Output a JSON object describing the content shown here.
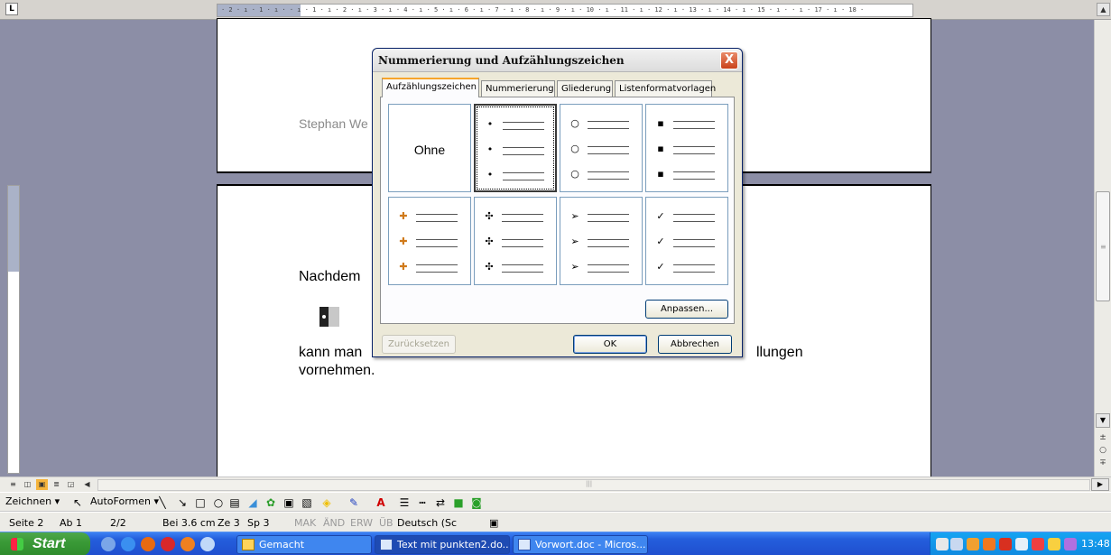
{
  "ruler": {
    "tab_selector": "L",
    "top_marks": "· 2 · ı · 1 · ı ·   · ı · 1 · ı · 2 · ı · 3 · ı · 4 · ı · 5 · ı · 6 · ı · 7 · ı · 8 · ı · 9 · ı · 10 · ı · 11 · ı · 12 · ı · 13 · ı · 14 · ı · 15 · ı ·  · ı · 17 · ı · 18 ·"
  },
  "document": {
    "page1_text": "Stephan We",
    "para1": "Nachdem",
    "para2_start": "kann man",
    "para2_end": "llungen",
    "para3": "vornehmen."
  },
  "dialog": {
    "title": "Nummerierung und Aufzählungszeichen",
    "close_label": "X",
    "tabs": [
      {
        "label": "Aufzählungszeichen",
        "active": true
      },
      {
        "label": "Nummerierung",
        "active": false
      },
      {
        "label": "Gliederung",
        "active": false
      },
      {
        "label": "Listenformatvorlagen",
        "active": false
      }
    ],
    "none_label": "Ohne",
    "bullet_styles": [
      {
        "symbol": "•",
        "color": "#000000",
        "selected": true
      },
      {
        "symbol": "○",
        "color": "#000000",
        "selected": false
      },
      {
        "symbol": "▪",
        "color": "#000000",
        "selected": false
      },
      {
        "symbol": "✚",
        "color": "#d07a1a",
        "selected": false
      },
      {
        "symbol": "✣",
        "color": "#000000",
        "selected": false
      },
      {
        "symbol": "➢",
        "color": "#000000",
        "selected": false
      },
      {
        "symbol": "✓",
        "color": "#000000",
        "selected": false
      }
    ],
    "customize_button": "Anpassen...",
    "reset_button": "Zurücksetzen",
    "ok_button": "OK",
    "cancel_button": "Abbrechen"
  },
  "drawing_toolbar": {
    "draw_menu": "Zeichnen ▾",
    "autoshapes_menu": "AutoFormen ▾"
  },
  "status_bar": {
    "page": "Seite 2",
    "section": "Ab 1",
    "page_of": "2/2",
    "position": "Bei 3.6 cm",
    "line": "Ze 3",
    "column": "Sp 3",
    "mak": "MAK",
    "aend": "ÄND",
    "erw": "ERW",
    "ueb": "ÜB",
    "language": "Deutsch (Sc"
  },
  "taskbar": {
    "start_label": "Start",
    "tasks": [
      {
        "label": "Gemacht",
        "active": false
      },
      {
        "label": "Text mit punkten2.do...",
        "active": true
      },
      {
        "label": "Vorwort.doc - Micros...",
        "active": false
      }
    ],
    "clock": "13:48"
  }
}
